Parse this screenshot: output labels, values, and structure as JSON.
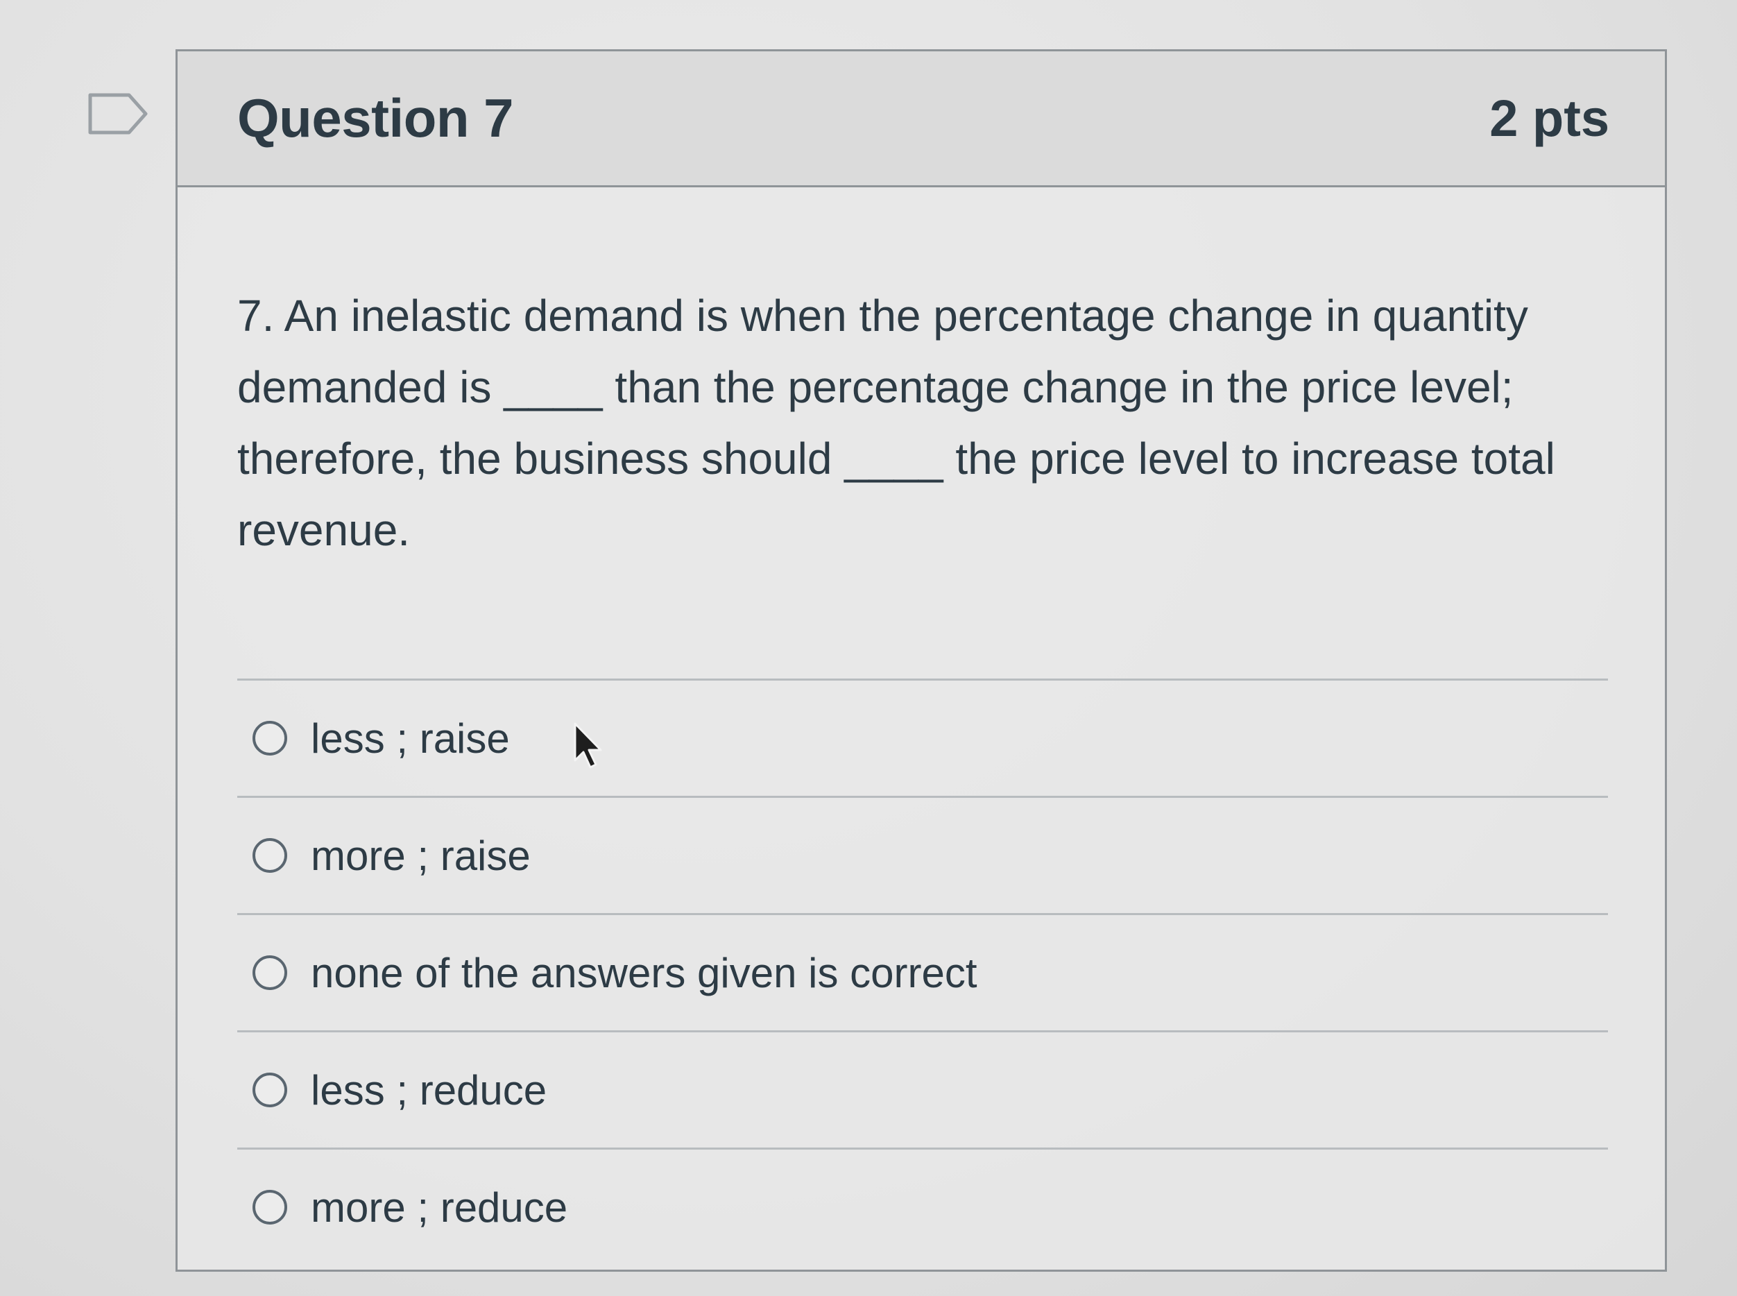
{
  "question": {
    "title": "Question 7",
    "points": "2 pts",
    "text": "7. An inelastic demand is when the percentage change in quantity demanded is ____ than the percentage change in the price level; therefore, the business should ____ the price level to increase total revenue."
  },
  "answers": [
    {
      "label": "less ; raise"
    },
    {
      "label": "more ; raise"
    },
    {
      "label": "none of the answers given is correct"
    },
    {
      "label": "less ; reduce"
    },
    {
      "label": "more ; reduce"
    }
  ],
  "icons": {
    "flag": "flag-question-icon",
    "cursor": "mouse-pointer-icon",
    "radio": "radio-button-icon"
  },
  "colors": {
    "text": "#2d3b45",
    "border": "#8f9498",
    "header_bg": "#d8d8d8"
  }
}
